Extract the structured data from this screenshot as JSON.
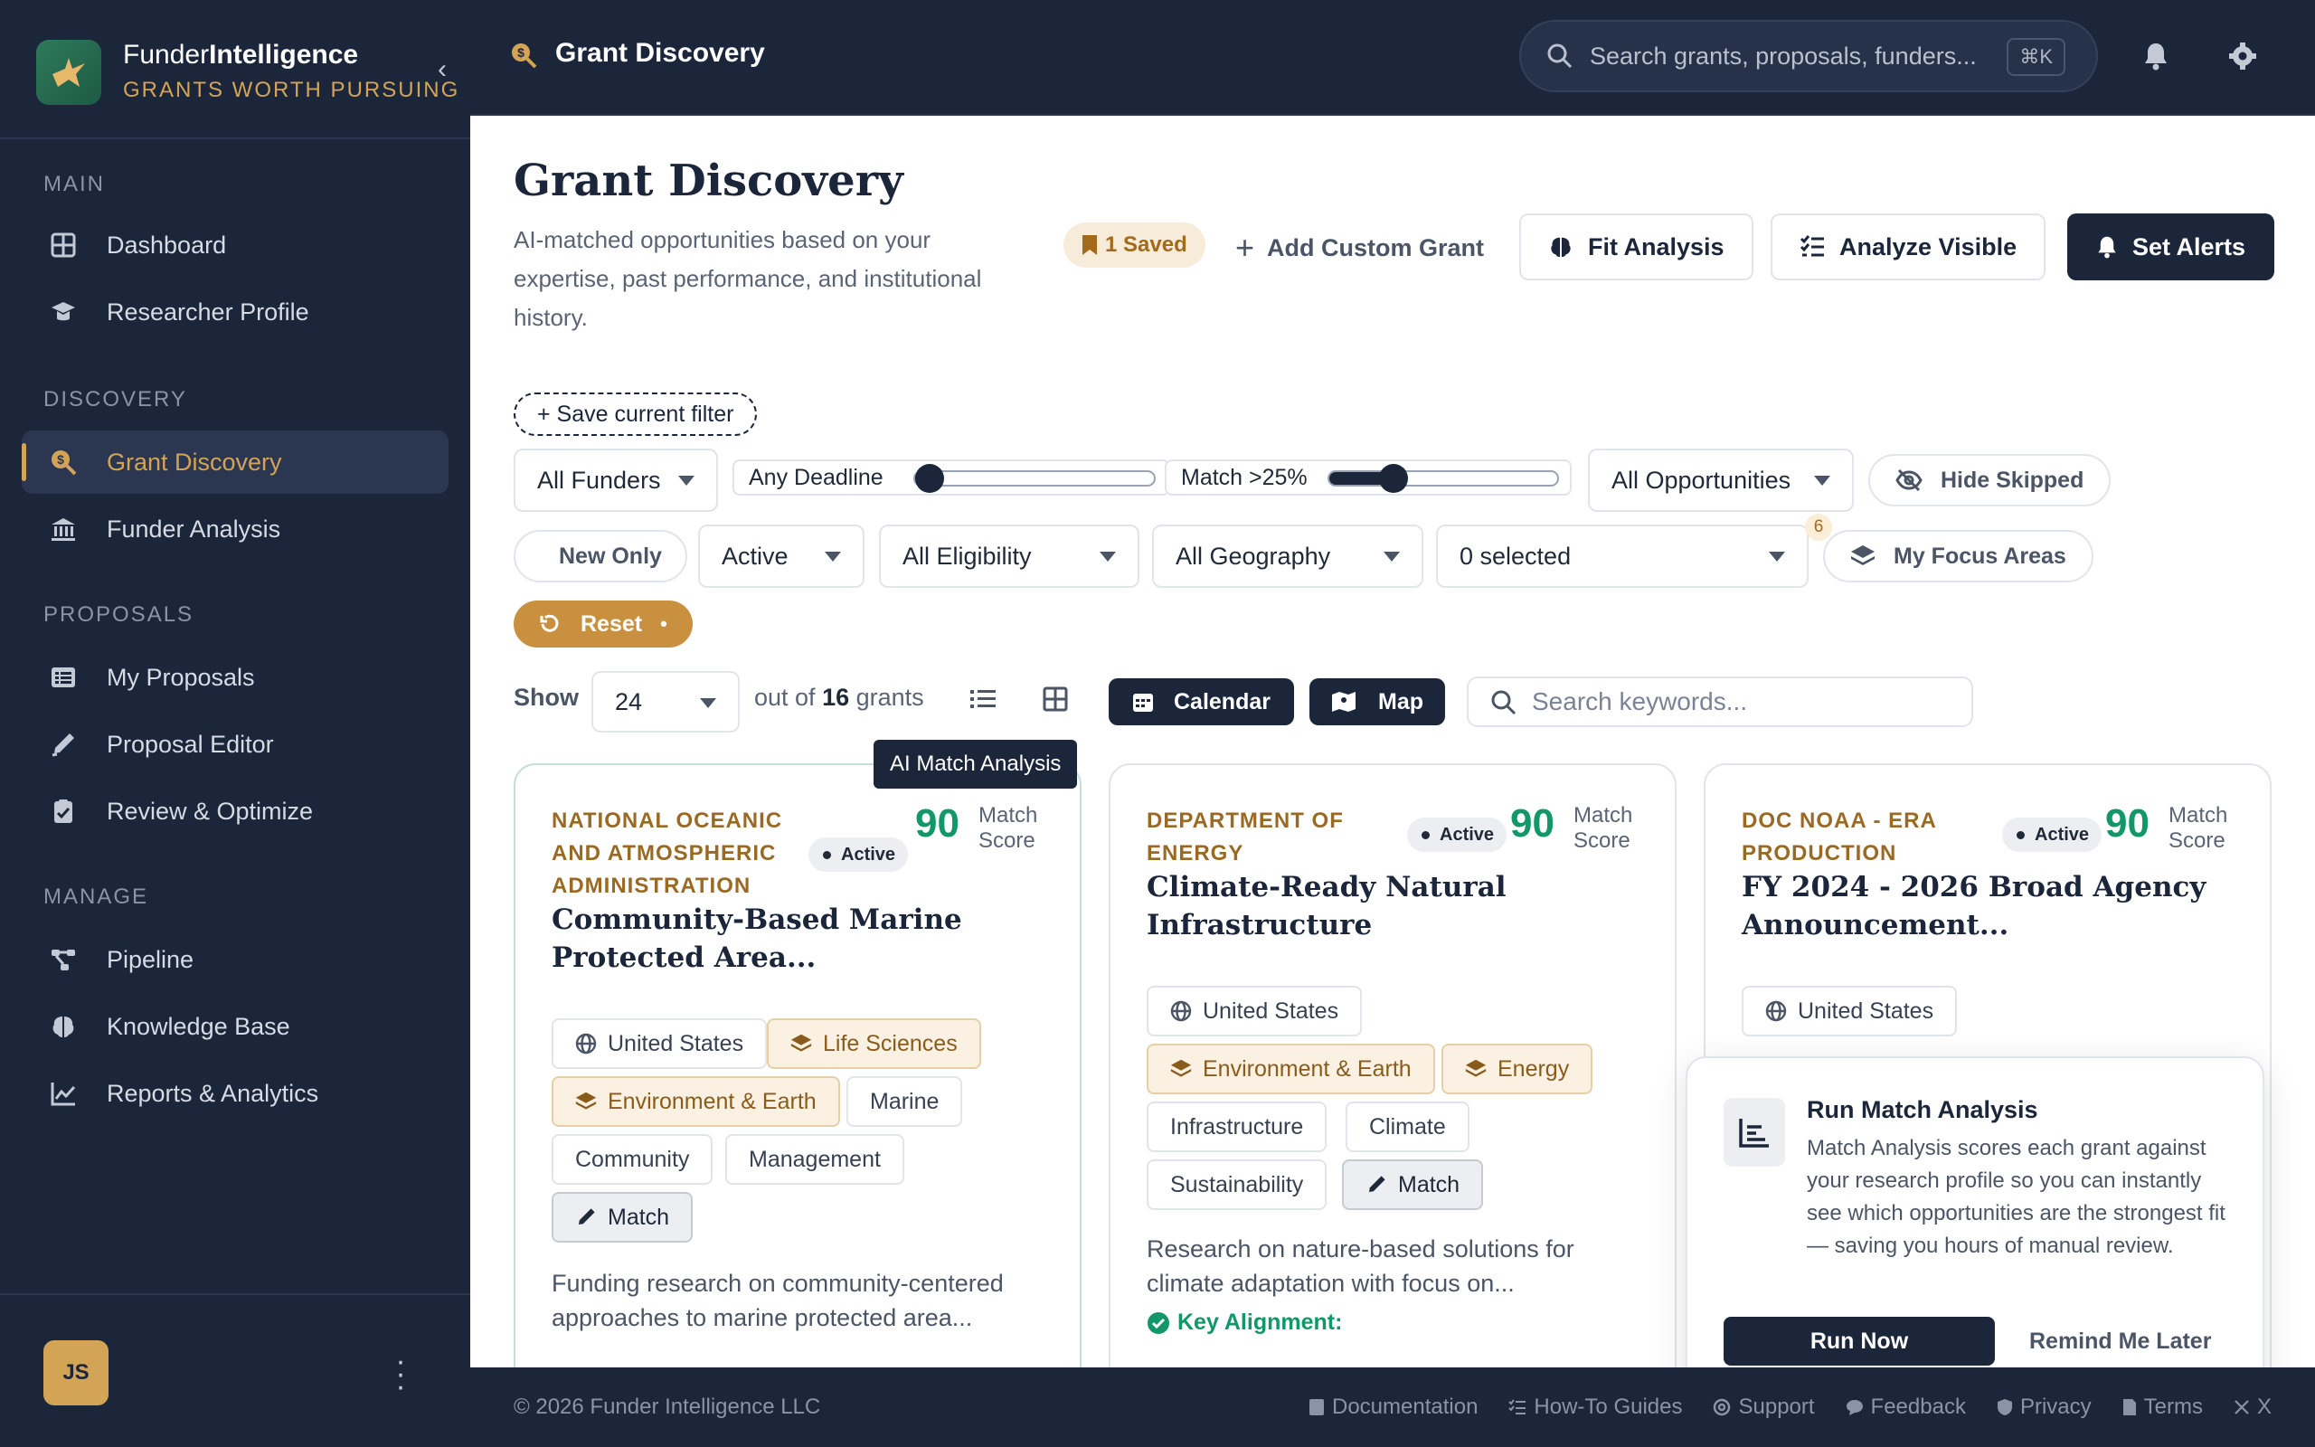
{
  "brand": {
    "name_regular": "Funder",
    "name_bold": "Intelligence",
    "tagline": "GRANTS WORTH PURSUING"
  },
  "sidebar": {
    "sections": {
      "main": "MAIN",
      "discovery": "DISCOVERY",
      "proposals": "PROPOSALS",
      "manage": "MANAGE"
    },
    "items": [
      {
        "label": "Dashboard",
        "icon": "grid-icon"
      },
      {
        "label": "Researcher Profile",
        "icon": "graduation-cap-icon"
      },
      {
        "label": "Grant Discovery",
        "icon": "search-dollar-icon",
        "active": true
      },
      {
        "label": "Funder Analysis",
        "icon": "bank-icon"
      },
      {
        "label": "My Proposals",
        "icon": "list-icon"
      },
      {
        "label": "Proposal Editor",
        "icon": "pen-icon"
      },
      {
        "label": "Review & Optimize",
        "icon": "clipboard-check-icon"
      },
      {
        "label": "Pipeline",
        "icon": "pipeline-icon"
      },
      {
        "label": "Knowledge Base",
        "icon": "brain-icon"
      },
      {
        "label": "Reports & Analytics",
        "icon": "chart-line-icon"
      }
    ],
    "user": {
      "initials": "JS",
      "name": "· · · ·"
    }
  },
  "header": {
    "title": "Grant Discovery",
    "search_placeholder": "Search grants, proposals, funders...",
    "search_shortcut": "⌘K"
  },
  "page": {
    "title": "Grant Discovery",
    "subtitle": "AI-matched opportunities based on your expertise, past performance, and institutional history.",
    "saved": "1 Saved",
    "add_custom": "Add Custom Grant",
    "fit_analysis": "Fit Analysis",
    "analyze_visible": "Analyze Visible",
    "set_alerts": "Set Alerts"
  },
  "filters": {
    "save_filter": "+ Save current filter",
    "funders": "All Funders",
    "deadline_label": "Any Deadline",
    "deadline_value": 0,
    "match_label": "Match >25%",
    "match_value": 25,
    "opportunities": "All Opportunities",
    "hide_skipped": "Hide Skipped",
    "new_only": "New Only",
    "status": "Active",
    "eligibility": "All Eligibility",
    "geography": "All Geography",
    "focus_selected": "0 selected",
    "focus_count": "6",
    "my_focus": "My Focus Areas",
    "reset": "Reset"
  },
  "results": {
    "show_label": "Show",
    "per_page": "24",
    "out_of_prefix": "out of",
    "total": "16",
    "out_of_suffix": "grants",
    "calendar": "Calendar",
    "map": "Map",
    "keyword_placeholder": "Search keywords...",
    "tooltip": "AI Match Analysis"
  },
  "cards": [
    {
      "agency": "NATIONAL OCEANIC AND ATMOSPHERIC ADMINISTRATION",
      "status": "Active",
      "score": "90",
      "score_label": "Match Score",
      "title": "Community-Based Marine Protected Area...",
      "tags": [
        "United States",
        "Life Sciences",
        "Environment & Earth",
        "Marine",
        "Community",
        "Management",
        "Match"
      ],
      "desc": "Funding research on community-centered approaches to marine protected area..."
    },
    {
      "agency": "DEPARTMENT OF ENERGY",
      "status": "Active",
      "score": "90",
      "score_label": "Match Score",
      "title": "Climate-Ready Natural Infrastructure",
      "tags": [
        "United States",
        "Environment & Earth",
        "Energy",
        "Infrastructure",
        "Climate",
        "Sustainability",
        "Match"
      ],
      "desc": "Research on nature-based solutions for climate adaptation with focus on...",
      "key_alignment": "Key Alignment:"
    },
    {
      "agency": "DOC NOAA - ERA PRODUCTION",
      "status": "Active",
      "score": "90",
      "score_label": "Match Score",
      "title": "FY 2024 - 2026 Broad Agency Announcement...",
      "tags": [
        "United States"
      ]
    }
  ],
  "popover": {
    "title": "Run Match Analysis",
    "body": "Match Analysis scores each grant against your research profile so you can instantly see which opportunities are the strongest fit — saving you hours of manual review.",
    "run_now": "Run Now",
    "remind": "Remind Me Later"
  },
  "footer": {
    "copyright": "© 2026 Funder Intelligence LLC",
    "links": [
      "Documentation",
      "How-To Guides",
      "Support",
      "Feedback",
      "Privacy",
      "Terms",
      "X"
    ]
  },
  "colors": {
    "navy": "#1b263b",
    "gold": "#d4a456",
    "green": "#12976a"
  }
}
